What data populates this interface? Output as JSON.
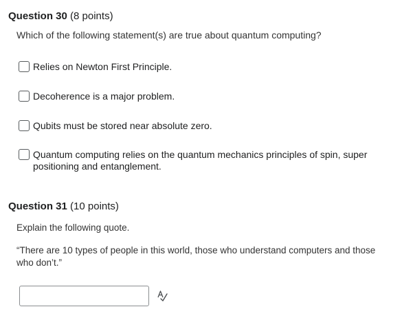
{
  "question30": {
    "title": "Question 30",
    "points": "(8 points)",
    "prompt": "Which of the following statement(s) are true about quantum computing?",
    "options": [
      {
        "label": "Relies on Newton First Principle.",
        "checked": false
      },
      {
        "label": "Decoherence is a major problem.",
        "checked": false
      },
      {
        "label": "Qubits must be stored near absolute zero.",
        "checked": false
      },
      {
        "label": "Quantum computing relies on the quantum mechanics principles of spin, super positioning and entanglement.",
        "checked": false
      }
    ]
  },
  "question31": {
    "title": "Question 31",
    "points": "(10 points)",
    "prompt": "Explain the following quote.",
    "quote": "“There are 10 types of people in this world, those who understand computers and those who don’t.”",
    "answer_value": "",
    "spellcheck_icon": "spell-check-icon"
  },
  "colors": {
    "text": "#202122",
    "border": "#565a5c",
    "input_border": "#8a8d90"
  }
}
